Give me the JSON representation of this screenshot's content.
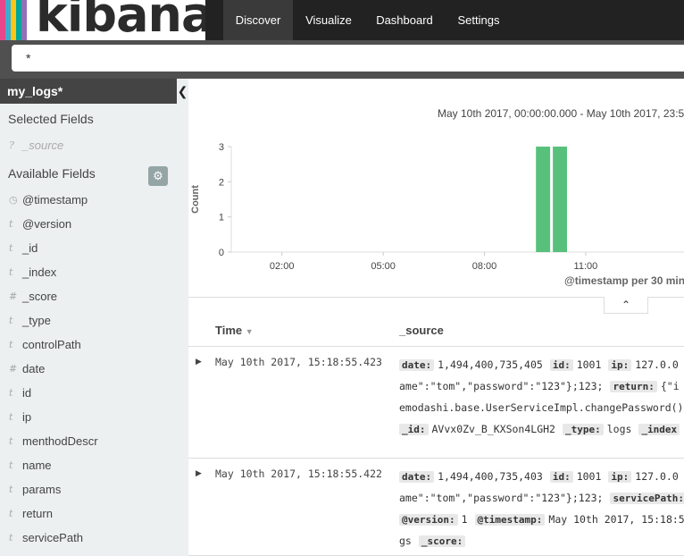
{
  "app": {
    "logo_text": "kibana",
    "logo_colors": [
      "#e8488b",
      "#3caed2",
      "#fec514",
      "#00a69b",
      "#9170b8"
    ],
    "nav": [
      "Discover",
      "Visualize",
      "Dashboard",
      "Settings"
    ],
    "active_nav": "Discover"
  },
  "query": {
    "value": "*"
  },
  "sidebar": {
    "index_pattern": "my_logs*",
    "selected_title": "Selected Fields",
    "selected_fields": [
      {
        "icon": "?",
        "name": "_source"
      }
    ],
    "available_title": "Available Fields",
    "available_fields": [
      {
        "icon": "clock",
        "name": "@timestamp"
      },
      {
        "icon": "t",
        "name": "@version"
      },
      {
        "icon": "t",
        "name": "_id"
      },
      {
        "icon": "t",
        "name": "_index"
      },
      {
        "icon": "#",
        "name": "_score"
      },
      {
        "icon": "t",
        "name": "_type"
      },
      {
        "icon": "t",
        "name": "controlPath"
      },
      {
        "icon": "#",
        "name": "date"
      },
      {
        "icon": "t",
        "name": "id"
      },
      {
        "icon": "t",
        "name": "ip"
      },
      {
        "icon": "t",
        "name": "menthodDescr"
      },
      {
        "icon": "t",
        "name": "name"
      },
      {
        "icon": "t",
        "name": "params"
      },
      {
        "icon": "t",
        "name": "return"
      },
      {
        "icon": "t",
        "name": "servicePath"
      }
    ]
  },
  "histogram": {
    "time_range": "May 10th 2017, 00:00:00.000 - May 10th 2017, 23:5",
    "y_label": "Count",
    "x_label": "@timestamp per 30 min",
    "x_ticks": [
      "02:00",
      "05:00",
      "08:00",
      "11:00"
    ],
    "y_ticks": [
      "0",
      "1",
      "2",
      "3"
    ]
  },
  "chart_data": {
    "type": "bar",
    "title": "",
    "xlabel": "@timestamp per 30 min",
    "ylabel": "Count",
    "ylim": [
      0,
      3
    ],
    "x_tick_hours": [
      2,
      5,
      8,
      11
    ],
    "bars": [
      {
        "start_hour": 9.5,
        "end_hour": 10.0,
        "count": 3
      },
      {
        "start_hour": 10.0,
        "end_hour": 10.5,
        "count": 3
      }
    ],
    "color": "#57c17b",
    "grid": false
  },
  "table": {
    "columns": [
      "Time",
      "_source"
    ],
    "rows": [
      {
        "time": "May 10th 2017, 15:18:55.423",
        "lines": [
          [
            {
              "k": "date:",
              "v": "1,494,400,735,405"
            },
            {
              "k": "id:",
              "v": "1001"
            },
            {
              "k": "ip:",
              "v": "127.0.0"
            }
          ],
          [
            {
              "v": "ame\":\"tom\",\"password\":\"123\"};123;"
            },
            {
              "k": "return:",
              "v": "{\"i"
            }
          ],
          [
            {
              "v": "emodashi.base.UserServiceImpl.changePassword()"
            }
          ],
          [
            {
              "k": "_id:",
              "v": "AVvx0Zv_B_KXSon4LGH2"
            },
            {
              "k": "_type:",
              "v": "logs"
            },
            {
              "k": "_index",
              "v": ""
            }
          ]
        ]
      },
      {
        "time": "May 10th 2017, 15:18:55.422",
        "lines": [
          [
            {
              "k": "date:",
              "v": "1,494,400,735,403"
            },
            {
              "k": "id:",
              "v": "1001"
            },
            {
              "k": "ip:",
              "v": "127.0.0"
            }
          ],
          [
            {
              "v": "ame\":\"tom\",\"password\":\"123\"};123;"
            },
            {
              "k": "servicePath:",
              "v": ""
            }
          ],
          [
            {
              "k": "@version:",
              "v": "1"
            },
            {
              "k": "@timestamp:",
              "v": "May 10th 2017, 15:18:5"
            }
          ],
          [
            {
              "v": "gs"
            },
            {
              "k": "_score:",
              "v": ""
            }
          ]
        ]
      }
    ]
  }
}
